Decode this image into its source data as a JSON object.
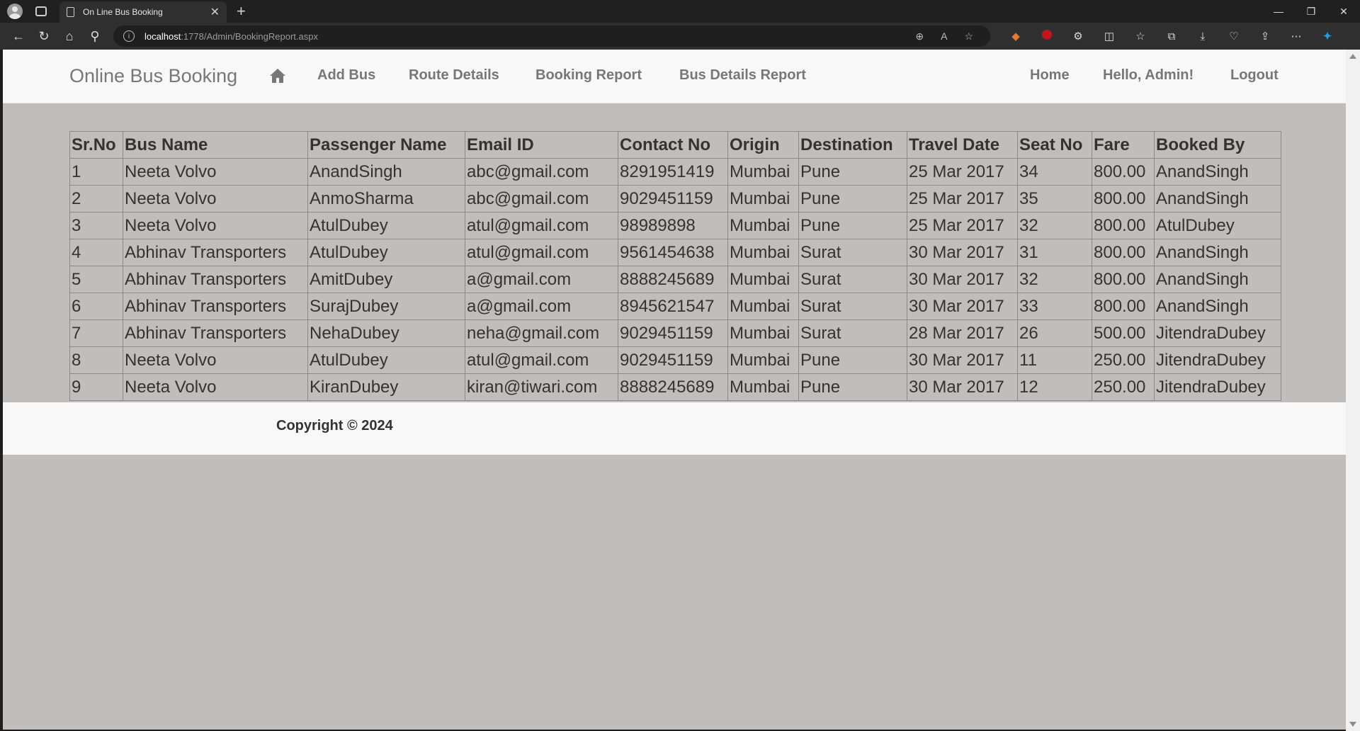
{
  "browser": {
    "tab_title": "On Line Bus Booking",
    "url_host": "localhost",
    "url_path": ":1778/Admin/BookingReport.aspx"
  },
  "navbar": {
    "brand": "Online Bus Booking",
    "links": [
      "Add Bus",
      "Route Details",
      "Booking Report",
      "Bus Details Report"
    ],
    "right_links": [
      "Home",
      "Hello, Admin!",
      "Logout"
    ]
  },
  "table": {
    "headers": [
      "Sr.No",
      "Bus Name",
      "Passenger Name",
      "Email ID",
      "Contact No",
      "Origin",
      "Destination",
      "Travel Date",
      "Seat No",
      "Fare",
      "Booked By"
    ],
    "rows": [
      [
        "1",
        "Neeta Volvo",
        "AnandSingh",
        "abc@gmail.com",
        "8291951419",
        "Mumbai",
        "Pune",
        "25 Mar 2017",
        "34",
        "800.00",
        "AnandSingh"
      ],
      [
        "2",
        "Neeta Volvo",
        "AnmoSharma",
        "abc@gmail.com",
        "9029451159",
        "Mumbai",
        "Pune",
        "25 Mar 2017",
        "35",
        "800.00",
        "AnandSingh"
      ],
      [
        "3",
        "Neeta Volvo",
        "AtulDubey",
        "atul@gmail.com",
        "98989898",
        "Mumbai",
        "Pune",
        "25 Mar 2017",
        "32",
        "800.00",
        "AtulDubey"
      ],
      [
        "4",
        "Abhinav Transporters",
        "AtulDubey",
        "atul@gmail.com",
        "9561454638",
        "Mumbai",
        "Surat",
        "30 Mar 2017",
        "31",
        "800.00",
        "AnandSingh"
      ],
      [
        "5",
        "Abhinav Transporters",
        "AmitDubey",
        "a@gmail.com",
        "8888245689",
        "Mumbai",
        "Surat",
        "30 Mar 2017",
        "32",
        "800.00",
        "AnandSingh"
      ],
      [
        "6",
        "Abhinav Transporters",
        "SurajDubey",
        "a@gmail.com",
        "8945621547",
        "Mumbai",
        "Surat",
        "30 Mar 2017",
        "33",
        "800.00",
        "AnandSingh"
      ],
      [
        "7",
        "Abhinav Transporters",
        "NehaDubey",
        "neha@gmail.com",
        "9029451159",
        "Mumbai",
        "Surat",
        "28 Mar 2017",
        "26",
        "500.00",
        "JitendraDubey"
      ],
      [
        "8",
        "Neeta Volvo",
        "AtulDubey",
        "atul@gmail.com",
        "9029451159",
        "Mumbai",
        "Pune",
        "30 Mar 2017",
        "11",
        "250.00",
        "JitendraDubey"
      ],
      [
        "9",
        "Neeta Volvo",
        "KiranDubey",
        "kiran@tiwari.com",
        "8888245689",
        "Mumbai",
        "Pune",
        "30 Mar 2017",
        "12",
        "250.00",
        "JitendraDubey"
      ]
    ]
  },
  "footer": {
    "copyright": "Copyright © 2024"
  }
}
